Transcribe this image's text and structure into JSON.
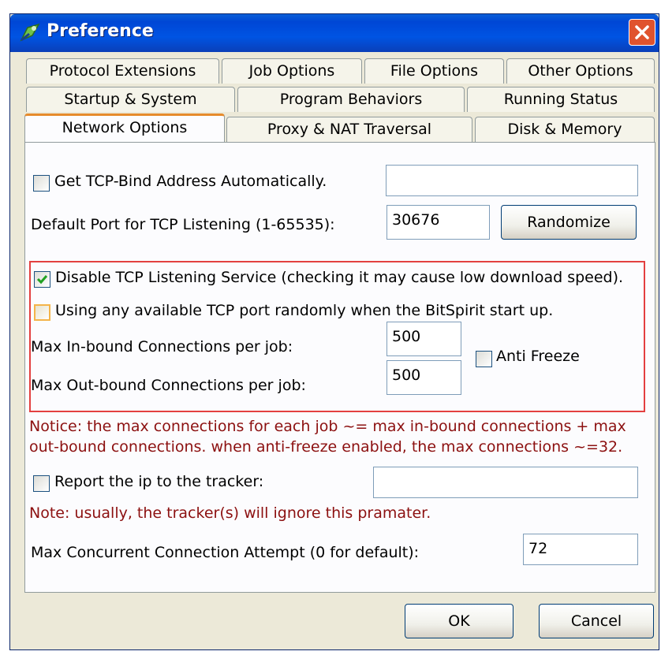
{
  "window": {
    "title": "Preference"
  },
  "tabs": {
    "row1": [
      "Protocol Extensions",
      "Job Options",
      "File Options",
      "Other Options"
    ],
    "row2": [
      "Startup & System",
      "Program Behaviors",
      "Running Status"
    ],
    "row3": [
      "Network Options",
      "Proxy & NAT Traversal",
      "Disk & Memory"
    ],
    "active": "Network Options"
  },
  "options": {
    "tcp_bind_auto": {
      "label": "Get TCP-Bind Address Automatically.",
      "checked": false,
      "value": ""
    },
    "default_port": {
      "label": "Default Port for TCP Listening (1-65535):",
      "value": "30676"
    },
    "randomize_label": "Randomize",
    "disable_listening": {
      "label": "Disable TCP Listening Service (checking it may cause low download speed).",
      "checked": true
    },
    "random_port": {
      "label": "Using any available TCP port randomly when the BitSpirit start up.",
      "checked": false
    },
    "max_inbound": {
      "label": "Max In-bound Connections per job:",
      "value": "500"
    },
    "max_outbound": {
      "label": "Max Out-bound Connections per job:",
      "value": "500"
    },
    "anti_freeze": {
      "label": "Anti Freeze",
      "checked": false
    },
    "notice_line1": "Notice: the max connections for each job ~= max in-bound connections + max",
    "notice_line2": "out-bound connections. when anti-freeze enabled, the max connections ~=32.",
    "report_ip": {
      "label": "Report the ip to the tracker:",
      "checked": false,
      "value": ""
    },
    "note": "Note: usually, the tracker(s) will ignore this pramater.",
    "max_concurrent": {
      "label": "Max Concurrent Connection Attempt (0 for default):",
      "value": "72"
    }
  },
  "footer": {
    "ok_label": "OK",
    "cancel_label": "Cancel"
  },
  "colors": {
    "title_bar": "#0054e3",
    "active_tab_accent": "#e68b2c",
    "notice_text": "#8c1010",
    "group_border": "#e34040"
  }
}
